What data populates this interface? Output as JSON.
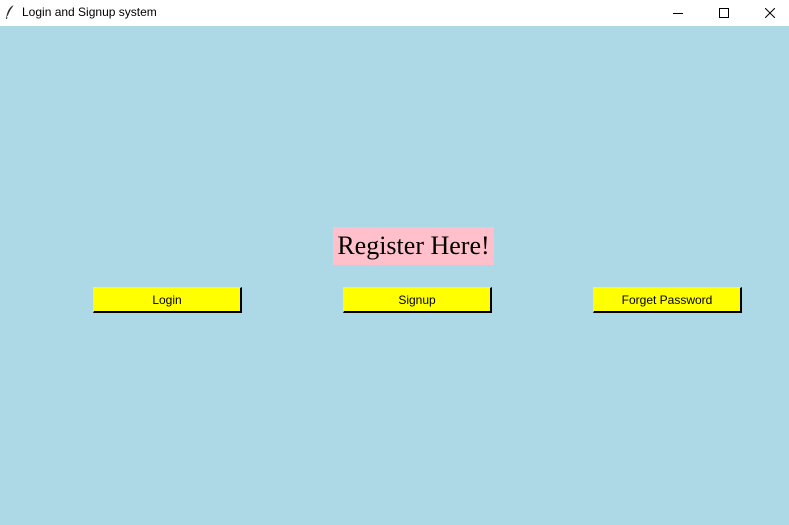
{
  "window": {
    "title": "Login and Signup system",
    "icon": "feather-icon",
    "controls": [
      "minimize-icon",
      "maximize-icon",
      "close-icon"
    ]
  },
  "colors": {
    "background": "#ADD8E6",
    "heading_background": "#FFC0CB",
    "button_background": "#FFFF00",
    "button_border": "#000000"
  },
  "main": {
    "heading": "Register Here!",
    "buttons": {
      "login": "Login",
      "signup": "Signup",
      "forget_password": "Forget Password"
    }
  }
}
